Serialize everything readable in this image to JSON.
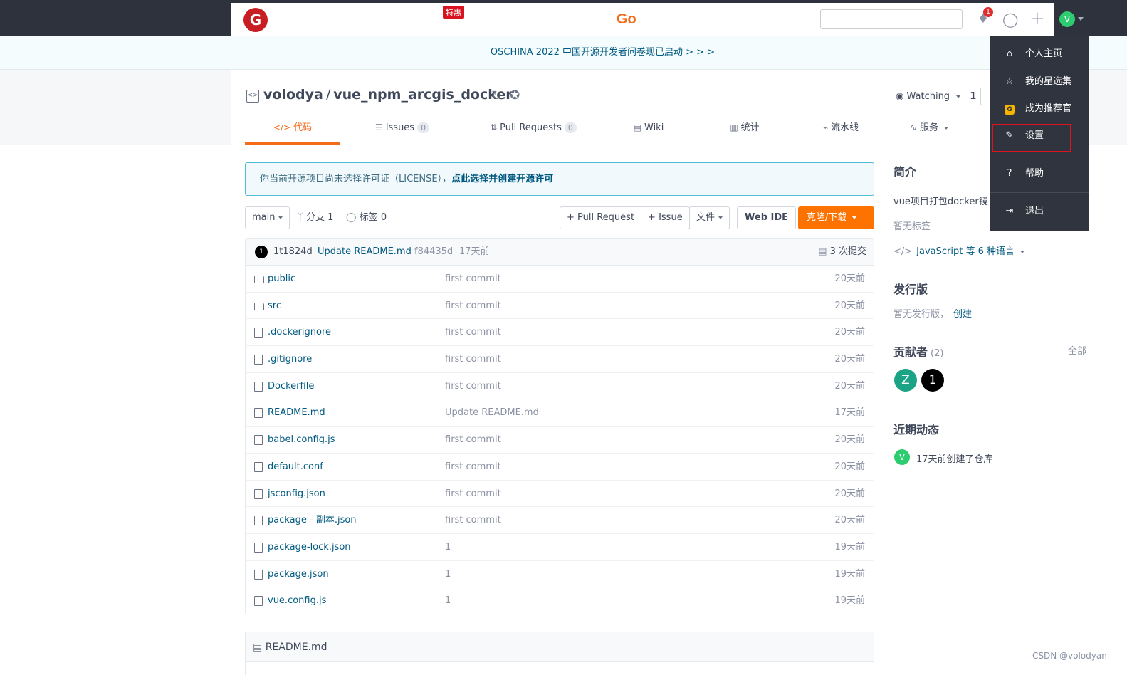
{
  "topbar": {
    "logo_text": "G",
    "promo_badge": "特惠",
    "go_text": "Go",
    "search_placeholder": "",
    "notification_count": "1",
    "avatar_letter": "V"
  },
  "announcement": {
    "text": "OSCHINA 2022 中国开源开发者问卷现已启动 > > >"
  },
  "repo": {
    "owner": "volodya",
    "separator": "/",
    "name": "vue_npm_arcgis_docker",
    "watch_label": "Watching",
    "watch_count": "1",
    "tabs": [
      {
        "icon": "</>",
        "label": "代码",
        "badge": null
      },
      {
        "icon": "☰",
        "label": "Issues",
        "badge": "0"
      },
      {
        "icon": "⇅",
        "label": "Pull Requests",
        "badge": "0"
      },
      {
        "icon": "▤",
        "label": "Wiki",
        "badge": null
      },
      {
        "icon": "▥",
        "label": "统计",
        "badge": null
      },
      {
        "icon": "⌁",
        "label": "流水线",
        "badge": null
      },
      {
        "icon": "∿",
        "label": "服务",
        "badge": null
      }
    ]
  },
  "license": {
    "text": "你当前开源项目尚未选择许可证（LICENSE），",
    "link": "点此选择并创建开源许可"
  },
  "toolbar": {
    "branch": "main",
    "branch_count": "分支 1",
    "tag_count": "标签 0",
    "pull_request": "+ Pull Request",
    "issue": "+ Issue",
    "file": "文件",
    "web_ide": "Web IDE",
    "clone": "克隆/下载"
  },
  "last_commit": {
    "avatar": "1",
    "author": "1t1824d",
    "message": "Update README.md",
    "sha": "f84435d",
    "time": "17天前",
    "commits": "3 次提交"
  },
  "files": [
    {
      "name": "public",
      "type": "folder",
      "commit": "first commit",
      "time": "20天前"
    },
    {
      "name": "src",
      "type": "folder",
      "commit": "first commit",
      "time": "20天前"
    },
    {
      "name": ".dockerignore",
      "type": "file",
      "commit": "first commit",
      "time": "20天前"
    },
    {
      "name": ".gitignore",
      "type": "file",
      "commit": "first commit",
      "time": "20天前"
    },
    {
      "name": "Dockerfile",
      "type": "file",
      "commit": "first commit",
      "time": "20天前"
    },
    {
      "name": "README.md",
      "type": "file",
      "commit": "Update README.md",
      "time": "17天前"
    },
    {
      "name": "babel.config.js",
      "type": "file",
      "commit": "first commit",
      "time": "20天前"
    },
    {
      "name": "default.conf",
      "type": "file",
      "commit": "first commit",
      "time": "20天前"
    },
    {
      "name": "jsconfig.json",
      "type": "file",
      "commit": "first commit",
      "time": "20天前"
    },
    {
      "name": "package - 副本.json",
      "type": "file",
      "commit": "first commit",
      "time": "20天前"
    },
    {
      "name": "package-lock.json",
      "type": "file",
      "commit": "1",
      "time": "19天前"
    },
    {
      "name": "package.json",
      "type": "file",
      "commit": "1",
      "time": "19天前"
    },
    {
      "name": "vue.config.js",
      "type": "file",
      "commit": "1",
      "time": "19天前"
    }
  ],
  "readme": {
    "title": "README.md"
  },
  "sidebar": {
    "intro_title": "简介",
    "description": "vue项目打包docker镜",
    "no_tags": "暂无标签",
    "language_link": "JavaScript 等 6 种语言",
    "release_title": "发行版",
    "no_release": "暂无发行版，",
    "create_link": "创建",
    "contributors_title": "贡献者",
    "contributors_count": "(2)",
    "all_link": "全部",
    "contributors": [
      {
        "letter": "Z",
        "color": "#1aa385"
      },
      {
        "letter": "1",
        "color": "#000000"
      }
    ],
    "activity_title": "近期动态",
    "activity_avatar": "V",
    "activity_text": "17天前创建了仓库"
  },
  "dropdown": {
    "items": [
      {
        "icon": "home-icon",
        "glyph": "⌂",
        "label": "个人主页"
      },
      {
        "icon": "star-icon",
        "glyph": "☆",
        "label": "我的星选集"
      },
      {
        "icon": "recommend-icon",
        "glyph": "G",
        "label": "成为推荐官"
      },
      {
        "icon": "edit-icon",
        "glyph": "✎",
        "label": "设置"
      },
      {
        "icon": "help-icon",
        "glyph": "?",
        "label": "帮助"
      },
      {
        "icon": "logout-icon",
        "glyph": "⇥",
        "label": "退出"
      }
    ]
  },
  "watermark": "CSDN @volodyan"
}
